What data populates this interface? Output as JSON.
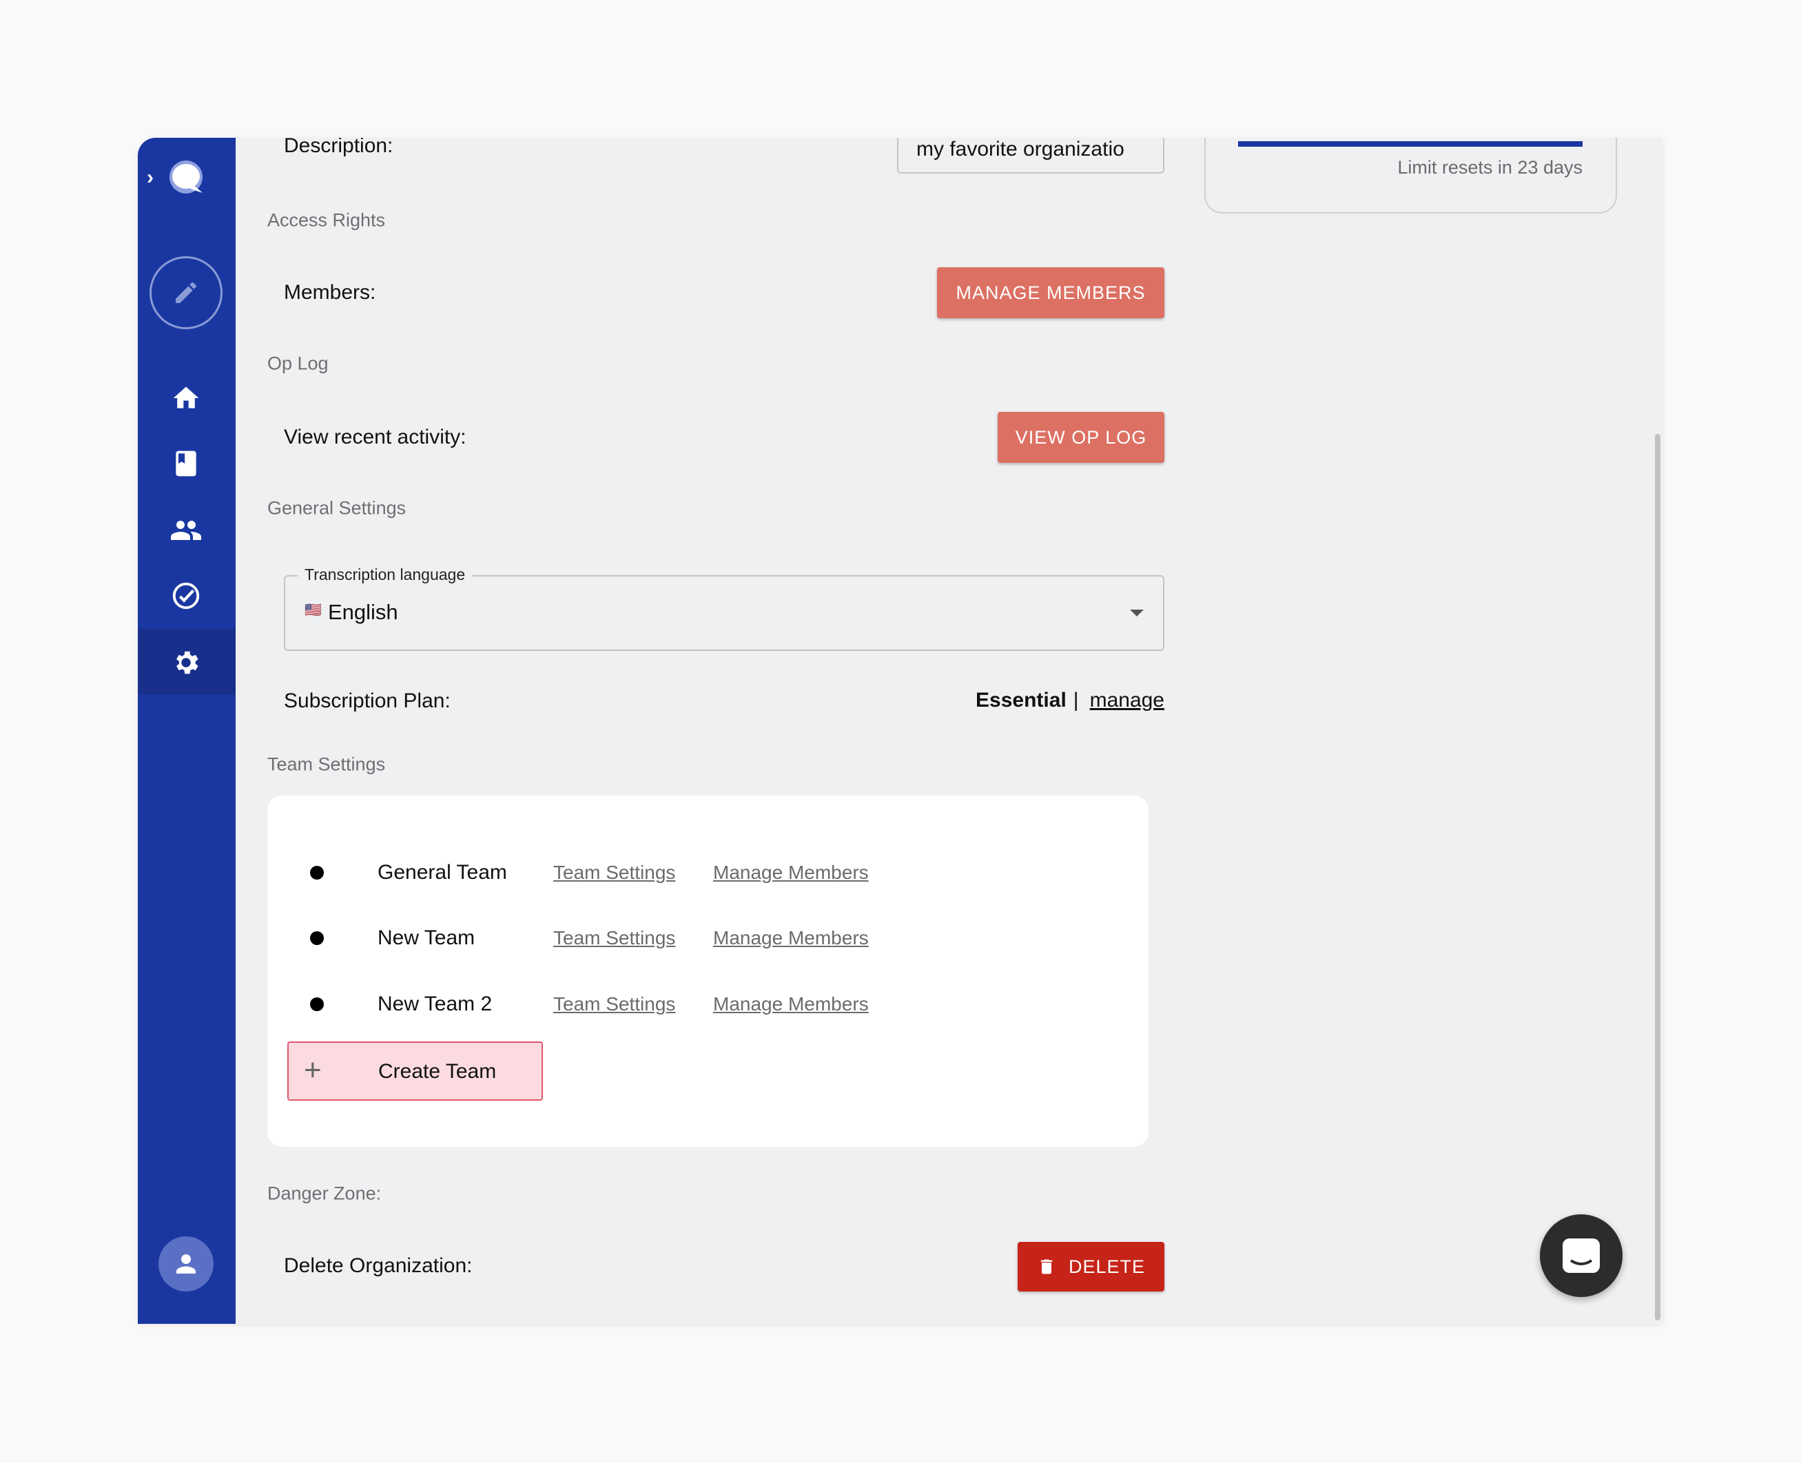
{
  "sidebar": {
    "items": [
      {
        "icon": "home-icon"
      },
      {
        "icon": "book-icon"
      },
      {
        "icon": "people-icon"
      },
      {
        "icon": "check-circle-icon"
      },
      {
        "icon": "gear-icon",
        "selected": true
      }
    ]
  },
  "general": {
    "description_label": "Description:",
    "description_value": "my favorite organizatio"
  },
  "access": {
    "section": "Access Rights",
    "members_label": "Members:",
    "manage_members": "MANAGE MEMBERS"
  },
  "oplog": {
    "section": "Op Log",
    "label": "View recent activity:",
    "button": "VIEW OP LOG"
  },
  "settings": {
    "section": "General Settings",
    "language_label": "Transcription language",
    "language_value": "English",
    "language_flag": "🇺🇸",
    "plan_label": "Subscription Plan:",
    "plan_value": "Essential",
    "plan_sep": "|",
    "plan_manage": "manage"
  },
  "teams": {
    "section": "Team Settings",
    "rows": [
      {
        "name": "General Team",
        "settings": "Team Settings",
        "members": "Manage Members"
      },
      {
        "name": "New Team",
        "settings": "Team Settings",
        "members": "Manage Members"
      },
      {
        "name": "New Team 2",
        "settings": "Team Settings",
        "members": "Manage Members"
      }
    ],
    "create": "Create Team"
  },
  "danger": {
    "section": "Danger Zone:",
    "label": "Delete Organization:",
    "button": "DELETE"
  },
  "usage": {
    "reset_text": "Limit resets in 23 days",
    "progress": 1.0
  },
  "colors": {
    "sidebar": "#1a37a1",
    "accent": "#dc7063",
    "danger": "#c62418"
  }
}
